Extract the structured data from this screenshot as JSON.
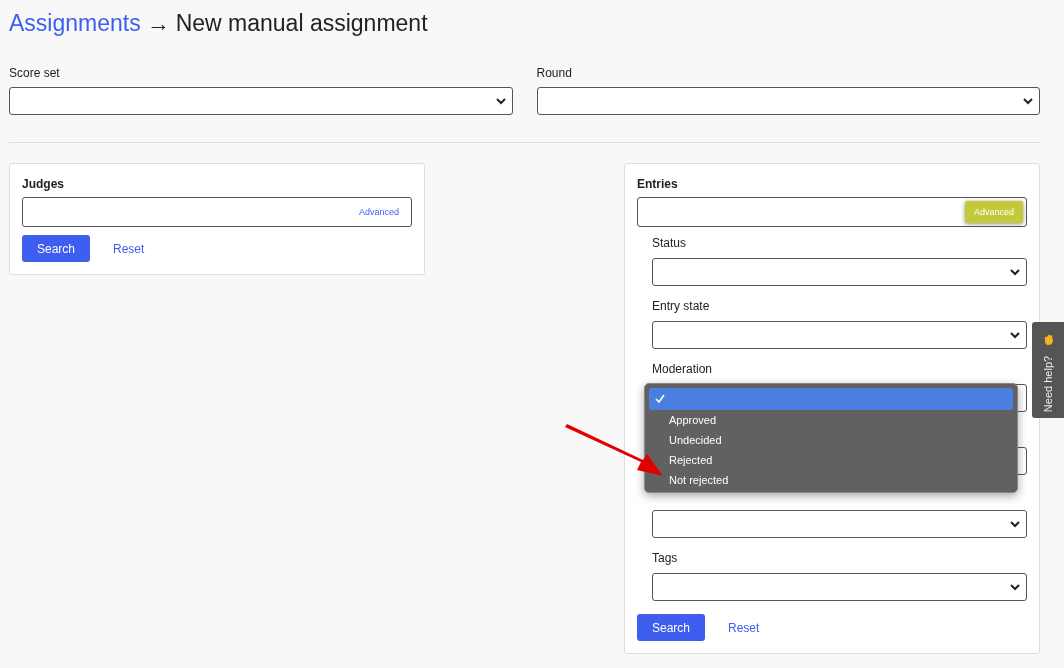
{
  "breadcrumb": {
    "parent": "Assignments",
    "separator": "→",
    "current": "New manual assignment"
  },
  "top_fields": [
    {
      "label": "Score set"
    },
    {
      "label": "Round"
    }
  ],
  "judges": {
    "title": "Judges",
    "advanced_link": "Advanced",
    "search_button": "Search",
    "reset_link": "Reset"
  },
  "entries": {
    "title": "Entries",
    "advanced_button": "Advanced",
    "search_button": "Search",
    "reset_link": "Reset",
    "filters": [
      {
        "kind": "select",
        "label": "Status"
      },
      {
        "kind": "select",
        "label": "Entry state"
      },
      {
        "kind": "select",
        "label": "Moderation",
        "menu": [
          {
            "selected": true
          },
          {
            "label": "Approved",
            "selected": false
          },
          {
            "label": "Undecided",
            "selected": false
          },
          {
            "label": "Rejected",
            "selected": false
          },
          {
            "label": "Not rejected",
            "selected": false
          }
        ]
      },
      {
        "kind": "select"
      },
      {
        "kind": "select"
      },
      {
        "kind": "select",
        "label": "Tags"
      }
    ]
  },
  "help_tab": {
    "label": "Need help?"
  }
}
